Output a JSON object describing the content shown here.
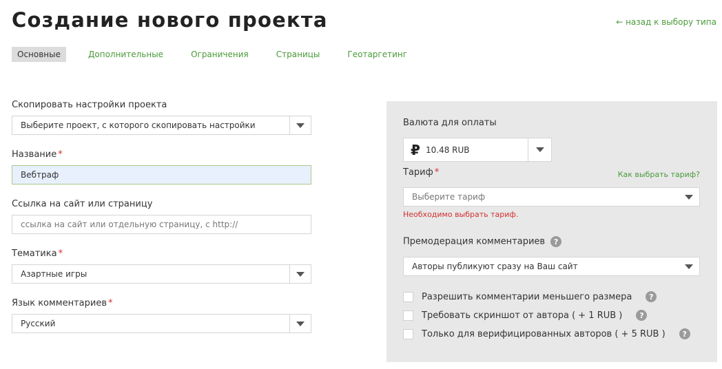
{
  "header": {
    "title": "Создание нового проекта",
    "back_link": "← назад к выбору типа"
  },
  "tabs": [
    {
      "label": "Основные",
      "active": true
    },
    {
      "label": "Дополнительные",
      "active": false
    },
    {
      "label": "Ограничения",
      "active": false
    },
    {
      "label": "Страницы",
      "active": false
    },
    {
      "label": "Геотаргетинг",
      "active": false
    }
  ],
  "form": {
    "copy_settings": {
      "label": "Скопировать настройки проекта",
      "value": "Выберите проект, с которого скопировать настройки"
    },
    "name": {
      "label": "Название",
      "required_mark": "*",
      "value": "Вебтраф"
    },
    "site_link": {
      "label": "Ссылка на сайт или страницу",
      "placeholder": "ссылка на сайт или отдельную страницу, с http://"
    },
    "topic": {
      "label": "Тематика",
      "required_mark": "*",
      "value": "Азартные игры"
    },
    "comment_language": {
      "label": "Язык комментариев",
      "required_mark": "*",
      "value": "Русский"
    }
  },
  "payment_panel": {
    "currency_label": "Валюта для оплаты",
    "currency_symbol": "₽",
    "currency_value": "10.48 RUB",
    "tariff_label": "Тариф",
    "tariff_required": "*",
    "tariff_help_link": "Как выбрать тариф?",
    "tariff_placeholder": "Выберите тариф",
    "tariff_error": "Необходимо выбрать тариф.",
    "premoderation_label": "Премодерация комментариев",
    "premoderation_value": "Авторы публикуют сразу на Ваш сайт",
    "help_glyph": "?",
    "options": [
      {
        "label": "Разрешить комментарии меньшего размера",
        "checked": false
      },
      {
        "label": "Требовать скриншот от автора ( + 1 RUB )",
        "checked": false
      },
      {
        "label": "Только для верифицированных авторов ( + 5 RUB )",
        "checked": false
      }
    ]
  },
  "colors": {
    "accent_green": "#4a9a3a",
    "error_red": "#d32f2f",
    "panel_bg": "#e8e8e8"
  }
}
